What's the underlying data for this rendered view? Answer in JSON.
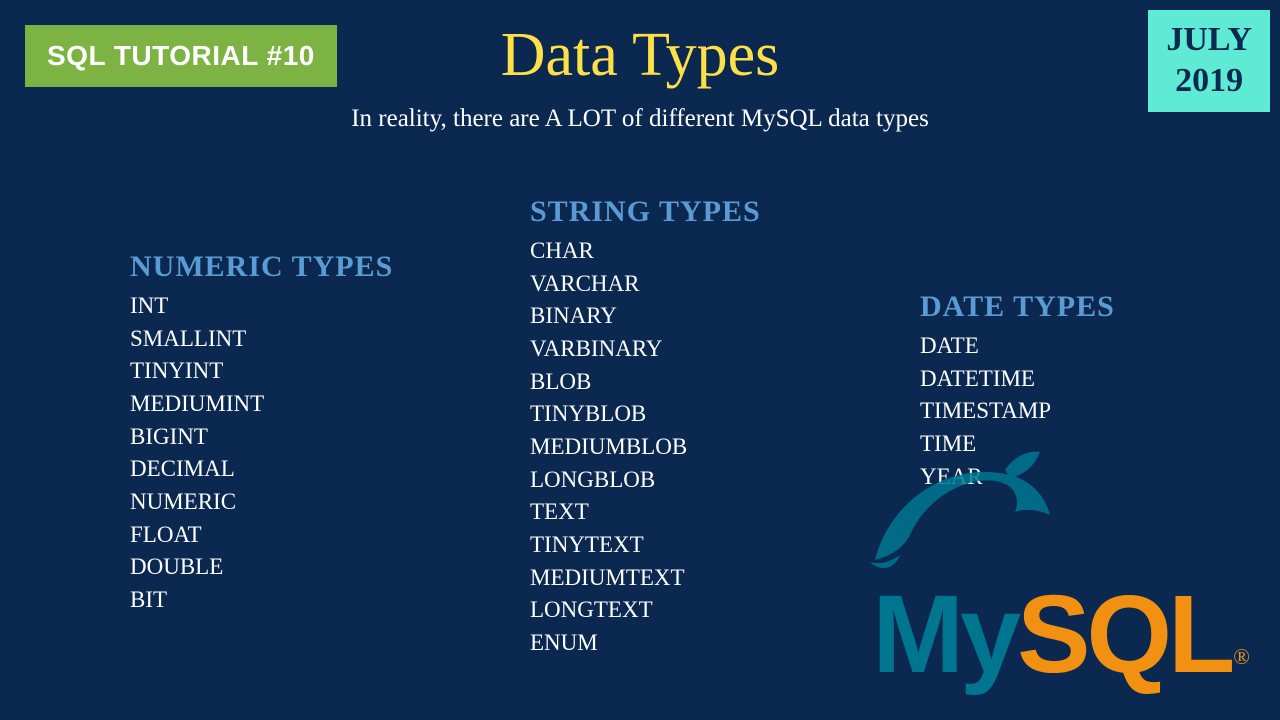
{
  "badge_left": "SQL TUTORIAL #10",
  "badge_right_line1": "JULY",
  "badge_right_line2": "2019",
  "title": "Data Types",
  "subtitle": "In reality, there are A LOT of different MySQL data types",
  "columns": {
    "numeric": {
      "heading": "NUMERIC TYPES",
      "items": [
        "INT",
        "SMALLINT",
        "TINYINT",
        "MEDIUMINT",
        "BIGINT",
        "DECIMAL",
        "NUMERIC",
        "FLOAT",
        "DOUBLE",
        "BIT"
      ]
    },
    "string": {
      "heading": "STRING TYPES",
      "items": [
        "CHAR",
        "VARCHAR",
        "BINARY",
        "VARBINARY",
        "BLOB",
        "TINYBLOB",
        "MEDIUMBLOB",
        "LONGBLOB",
        "TEXT",
        "TINYTEXT",
        "MEDIUMTEXT",
        "LONGTEXT",
        "ENUM"
      ]
    },
    "date": {
      "heading": "DATE TYPES",
      "items": [
        "DATE",
        "DATETIME",
        "TIMESTAMP",
        "TIME",
        "YEAR"
      ]
    }
  },
  "logo": {
    "part1": "My",
    "part2": "SQL",
    "reg": "®"
  }
}
